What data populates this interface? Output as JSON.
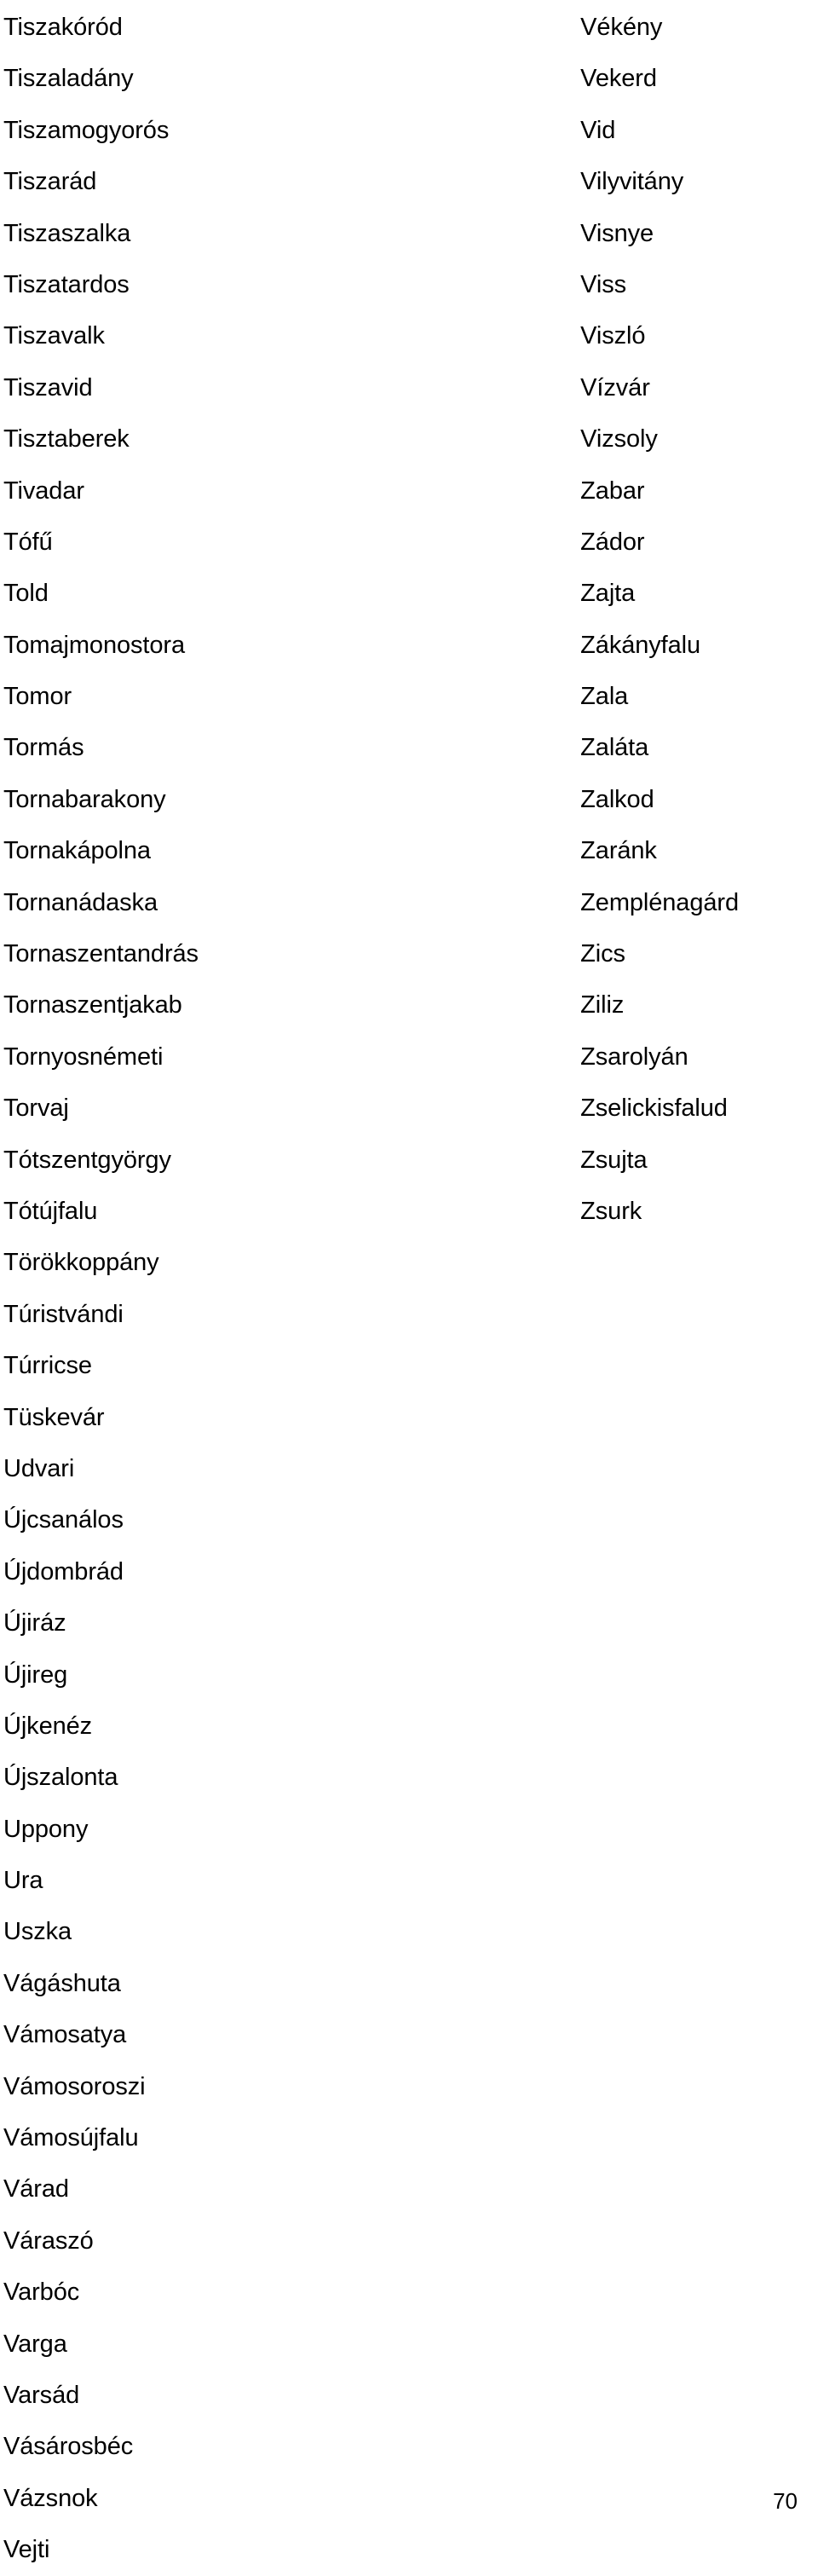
{
  "document": {
    "page_number": "70",
    "columns": [
      {
        "name": "left-column",
        "entries": [
          "Tiszakóród",
          "Tiszaladány",
          "Tiszamogyorós",
          "Tiszarád",
          "Tiszaszalka",
          "Tiszatardos",
          "Tiszavalk",
          "Tiszavid",
          "Tisztaberek",
          "Tivadar",
          "Tófű",
          "Told",
          "Tomajmonostora",
          "Tomor",
          "Tormás",
          "Tornabarakony",
          "Tornakápolna",
          "Tornanádaska",
          "Tornaszentandrás",
          "Tornaszentjakab",
          "Tornyosnémeti",
          "Torvaj",
          "Tótszentgyörgy",
          "Tótújfalu",
          "Törökkoppány",
          "Túristvándi",
          "Túrricse",
          "Tüskevár",
          "Udvari",
          "Újcsanálos",
          "Újdombrád",
          "Újiráz",
          "Újireg",
          "Újkenéz",
          "Újszalonta",
          "Uppony",
          "Ura",
          "Uszka",
          "Vágáshuta",
          "Vámosatya",
          "Vámosoroszi",
          "Vámosújfalu",
          "Várad",
          "Váraszó",
          "Varbóc",
          "Varga",
          "Varsád",
          "Vásárosbéc",
          "Vázsnok",
          "Vejti"
        ]
      },
      {
        "name": "right-column",
        "entries": [
          "Vékény",
          "Vekerd",
          "Vid",
          "Vilyvitány",
          "Visnye",
          "Viss",
          "Viszló",
          "Vízvár",
          "Vizsoly",
          "Zabar",
          "Zádor",
          "Zajta",
          "Zákányfalu",
          "Zala",
          "Zaláta",
          "Zalkod",
          "Zaránk",
          "Zemplénagárd",
          "Zics",
          "Ziliz",
          "Zsarolyán",
          "Zselickisfalud",
          "Zsujta",
          "Zsurk"
        ]
      }
    ]
  }
}
